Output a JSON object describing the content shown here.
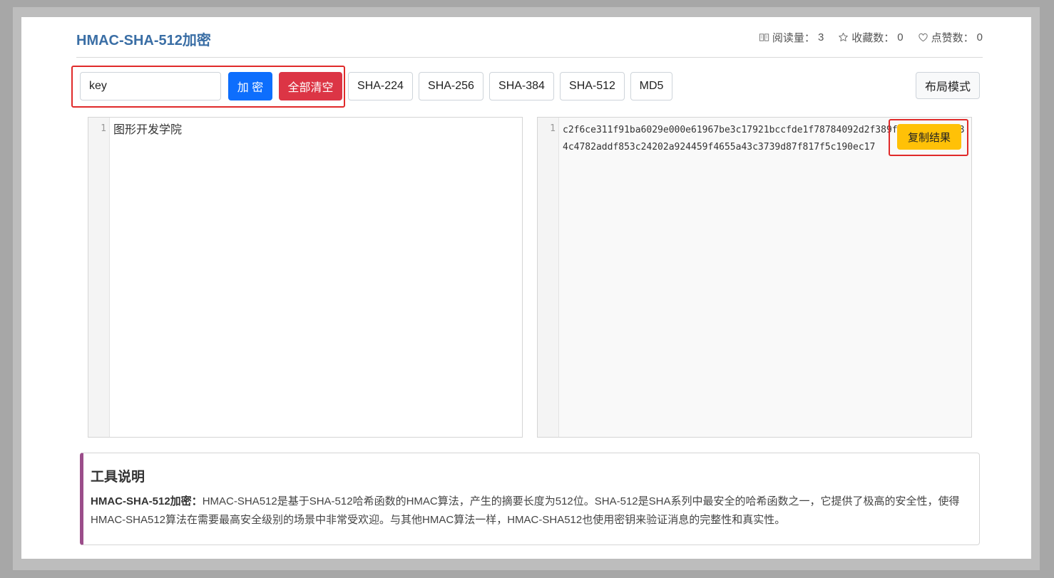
{
  "header": {
    "title": "HMAC-SHA-512加密",
    "stats": {
      "read_label": "阅读量：",
      "read_count": "3",
      "fav_label": "收藏数：",
      "fav_count": "0",
      "like_label": "点赞数：",
      "like_count": "0"
    }
  },
  "toolbar": {
    "key_value": "key",
    "encrypt_label": "加 密",
    "clear_label": "全部清空",
    "algos": [
      "SHA-224",
      "SHA-256",
      "SHA-384",
      "SHA-512",
      "MD5"
    ],
    "layout_label": "布局模式"
  },
  "input_editor": {
    "line_number": "1",
    "text": "图形开发学院"
  },
  "output_editor": {
    "line_number": "1",
    "text": "c2f6ce311f91ba6029e000e61967be3c17921bccfde1f78784092d2f389f5dc594f959034c4782addf853c24202a924459f4655a43c3739d87f817f5c190ec17",
    "copy_label": "复制结果"
  },
  "description": {
    "title": "工具说明",
    "lead": "HMAC-SHA-512加密：",
    "body": "HMAC-SHA512是基于SHA-512哈希函数的HMAC算法，产生的摘要长度为512位。SHA-512是SHA系列中最安全的哈希函数之一，它提供了极高的安全性，使得HMAC-SHA512算法在需要最高安全级别的场景中非常受欢迎。与其他HMAC算法一样，HMAC-SHA512也使用密钥来验证消息的完整性和真实性。"
  },
  "colors": {
    "title": "#3a6ea5",
    "primary": "#0d6efd",
    "danger": "#dc3545",
    "warning": "#ffc107",
    "highlight": "#e02a2a",
    "desc_accent": "#9b4d8a"
  }
}
